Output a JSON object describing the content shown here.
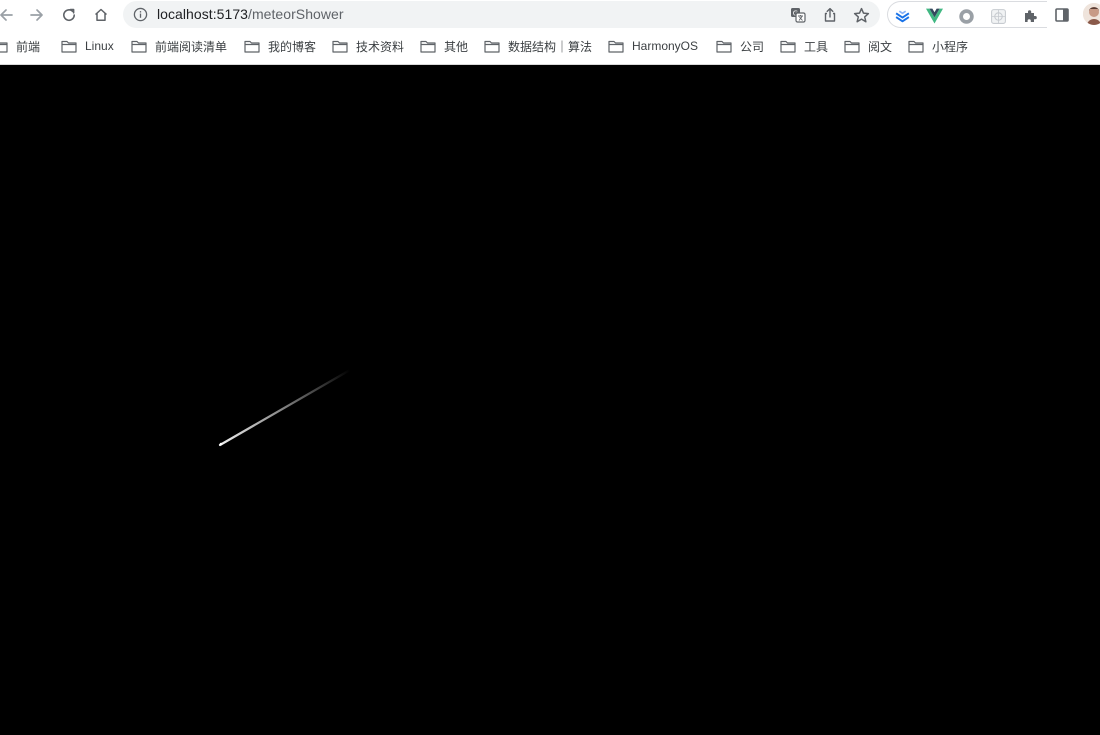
{
  "browser": {
    "url_host": "localhost:5173",
    "url_path": "/meteorShower",
    "bookmarks": [
      {
        "label": "前端"
      },
      {
        "label": "Linux"
      },
      {
        "label": "前端阅读清单"
      },
      {
        "label": "我的博客"
      },
      {
        "label": "技术资料"
      },
      {
        "label": "其他"
      },
      {
        "label": "数据结构｜算法"
      },
      {
        "label": "HarmonyOS"
      },
      {
        "label": "公司"
      },
      {
        "label": "工具"
      },
      {
        "label": "阅文"
      },
      {
        "label": "小程序"
      }
    ],
    "icons": {
      "back": "back-arrow-icon",
      "forward": "forward-arrow-icon",
      "reload": "reload-icon",
      "home": "home-icon",
      "site_info": "info-icon",
      "translate": "translate-icon",
      "share": "share-icon",
      "bookmark_star": "star-icon",
      "extensions": "puzzle-icon",
      "side_panel": "side-panel-icon",
      "folder": "folder-icon"
    }
  },
  "colors": {
    "page_background": "#000000",
    "meteor": "#ffffff",
    "vue_green": "#41b883",
    "vue_dark": "#34495e",
    "chrome_toolbar": "#ffffff",
    "omnibox": "#f1f3f4"
  }
}
